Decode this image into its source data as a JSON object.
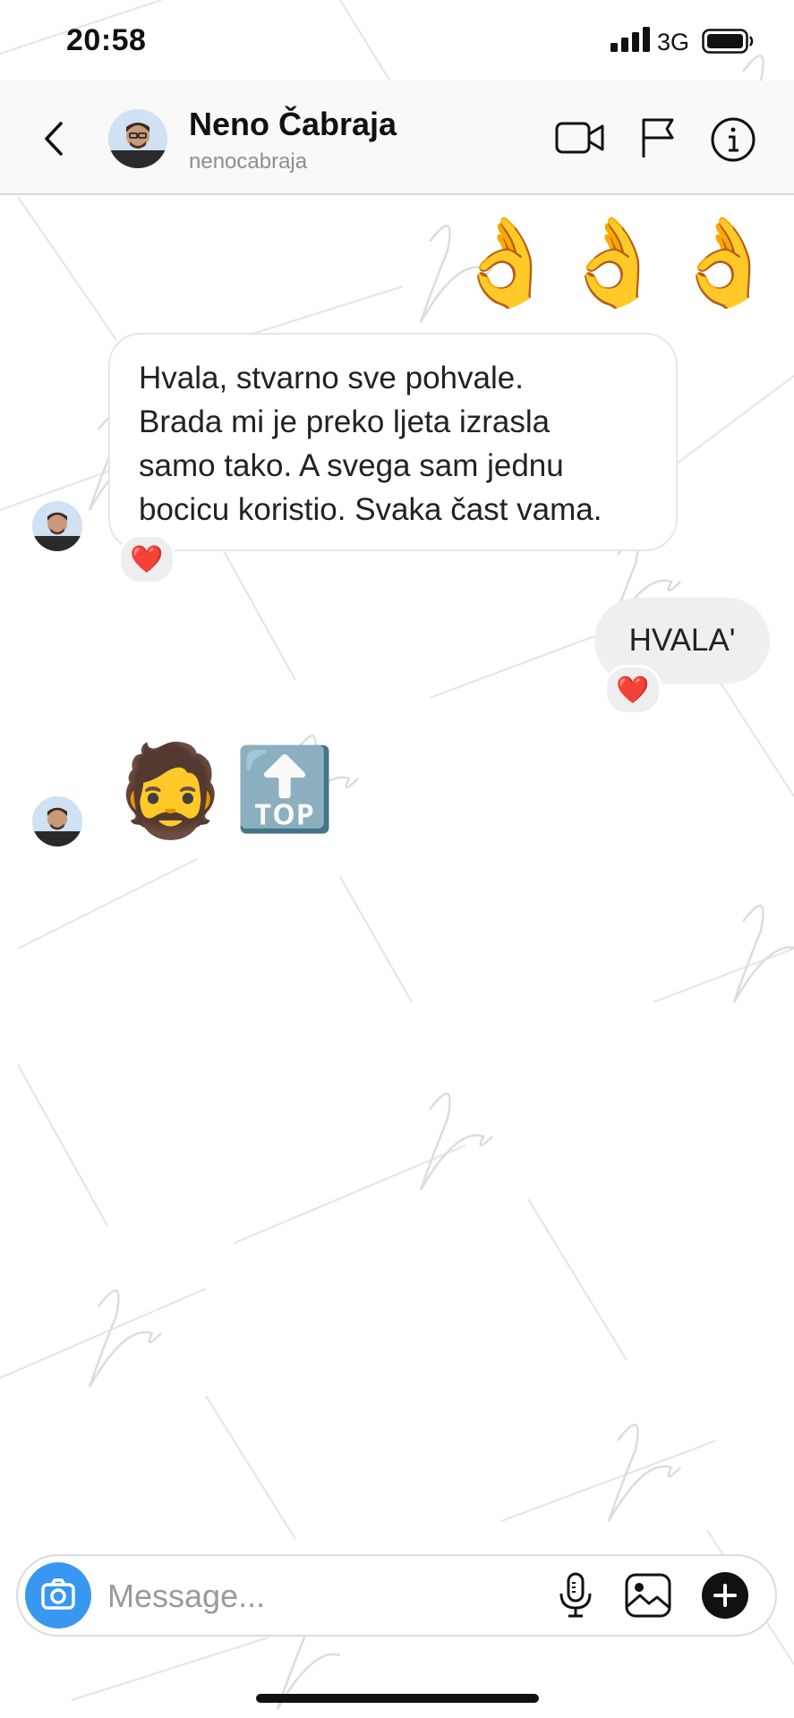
{
  "status_bar": {
    "time": "20:58",
    "network": "3G",
    "battery_level": 1.0
  },
  "header": {
    "name": "Neno Čabraja",
    "username": "nenocabraja",
    "icons": [
      "back-chevron-icon",
      "video-call-icon",
      "flag-icon",
      "info-icon"
    ]
  },
  "messages": [
    {
      "type": "emoji",
      "direction": "outgoing",
      "emoji": [
        "👌",
        "👌",
        "👌"
      ]
    },
    {
      "type": "text",
      "direction": "incoming",
      "text": "Hvala, stvarno sve pohvale.\nBrada mi je preko ljeta izrasla\nsamo tako. A svega sam jednu\nbocicu koristio. Svaka čast vama.",
      "reaction": "❤️"
    },
    {
      "type": "text",
      "direction": "outgoing",
      "text": "HVALA'",
      "reaction": "❤️"
    },
    {
      "type": "emoji",
      "direction": "incoming",
      "emoji": [
        "🧔",
        "🔝"
      ]
    }
  ],
  "composer": {
    "placeholder": "Message...",
    "icons": [
      "camera-icon",
      "microphone-icon",
      "gallery-icon",
      "plus-icon"
    ]
  },
  "colors": {
    "accent": "#3897f0",
    "bubble_gray": "#efefef",
    "reaction_red": "#e0202a"
  }
}
